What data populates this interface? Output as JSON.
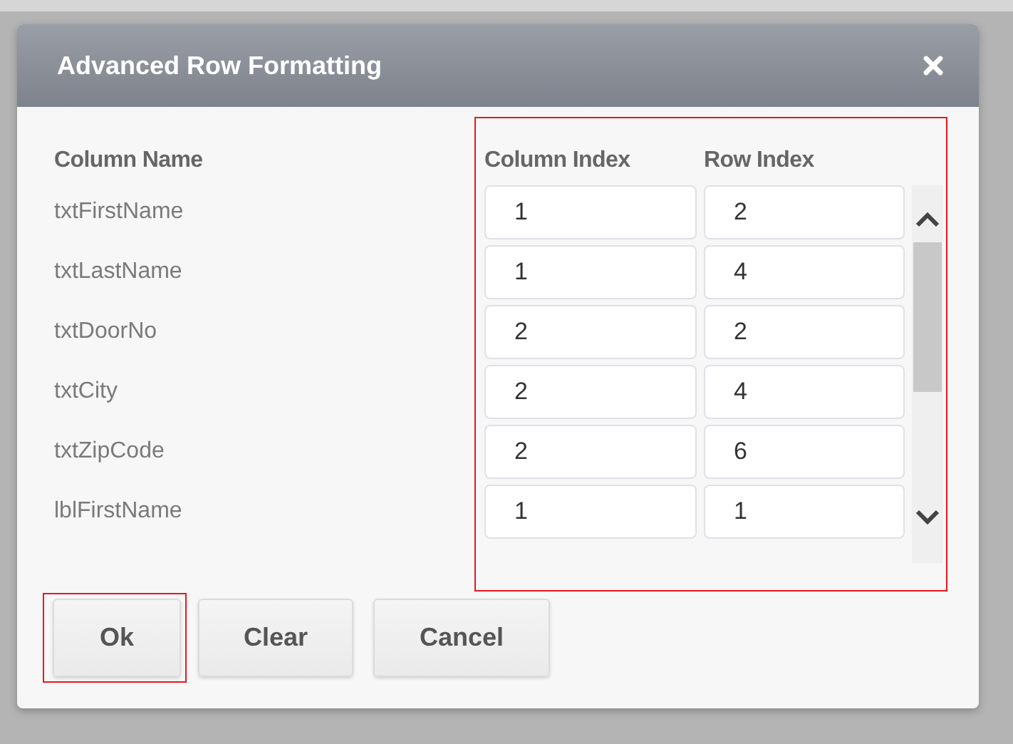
{
  "dialog": {
    "title": "Advanced Row Formatting"
  },
  "table": {
    "columns": [
      "Column Name",
      "Column Index",
      "Row Index"
    ],
    "rows": [
      {
        "name": "txtFirstName",
        "column_index": "1",
        "row_index": "2"
      },
      {
        "name": "txtLastName",
        "column_index": "1",
        "row_index": "4"
      },
      {
        "name": "txtDoorNo",
        "column_index": "2",
        "row_index": "2"
      },
      {
        "name": "txtCity",
        "column_index": "2",
        "row_index": "4"
      },
      {
        "name": "txtZipCode",
        "column_index": "2",
        "row_index": "6"
      },
      {
        "name": "lblFirstName",
        "column_index": "1",
        "row_index": "1"
      }
    ]
  },
  "buttons": [
    "Ok",
    "Clear",
    "Cancel"
  ]
}
